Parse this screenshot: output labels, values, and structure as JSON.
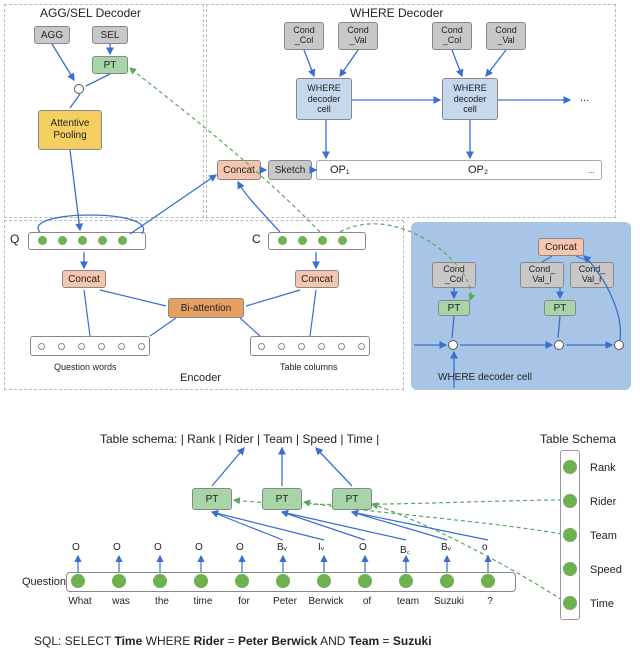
{
  "top": {
    "agg_sel_title": "AGG/SEL Decoder",
    "where_title": "WHERE Decoder",
    "agg": "AGG",
    "sel": "SEL",
    "pt": "PT",
    "cond_col": "Cond\n_Col",
    "cond_val": "Cond\n_Val",
    "cond_val_l": "Cond_\nVal_l",
    "cond_val_r": "Cond_\nVal_r",
    "attentive_pooling": "Attentive\nPooling",
    "concat": "Concat",
    "sketch": "Sketch",
    "op1": "OP₁",
    "op2": "OP₂",
    "ellipsis": "...",
    "where_cell": "WHERE\ndecoder\ncell",
    "where_cell_label": "WHERE decoder cell",
    "q_label": "Q",
    "c_label": "C",
    "biattention": "Bi-attention",
    "question_words": "Question words",
    "table_columns": "Table columns",
    "encoder": "Encoder"
  },
  "bottom": {
    "table_schema": "Table schema: | Rank | Rider | Team | Speed | Time |",
    "schema_title": "Table Schema",
    "schema_items": [
      "Rank",
      "Rider",
      "Team",
      "Speed",
      "Time"
    ],
    "pt": "PT",
    "question_label": "Question",
    "words": [
      "What",
      "was",
      "the",
      "time",
      "for",
      "Peter",
      "Berwick",
      "of",
      "team",
      "Suzuki",
      "?"
    ],
    "tags": [
      "O",
      "O",
      "O",
      "O",
      "O",
      "Bᵥ",
      "Iᵥ",
      "O",
      "B꜀",
      "Bᵥ",
      "o"
    ],
    "sql_prefix": "SQL:  SELECT ",
    "sql_parts": {
      "time": "Time",
      "where": " WHERE ",
      "rider": "Rider",
      "eq1": " = ",
      "pb": "Peter Berwick",
      "and": " AND ",
      "team": "Team",
      "eq2": " = ",
      "suz": "Suzuki"
    }
  }
}
